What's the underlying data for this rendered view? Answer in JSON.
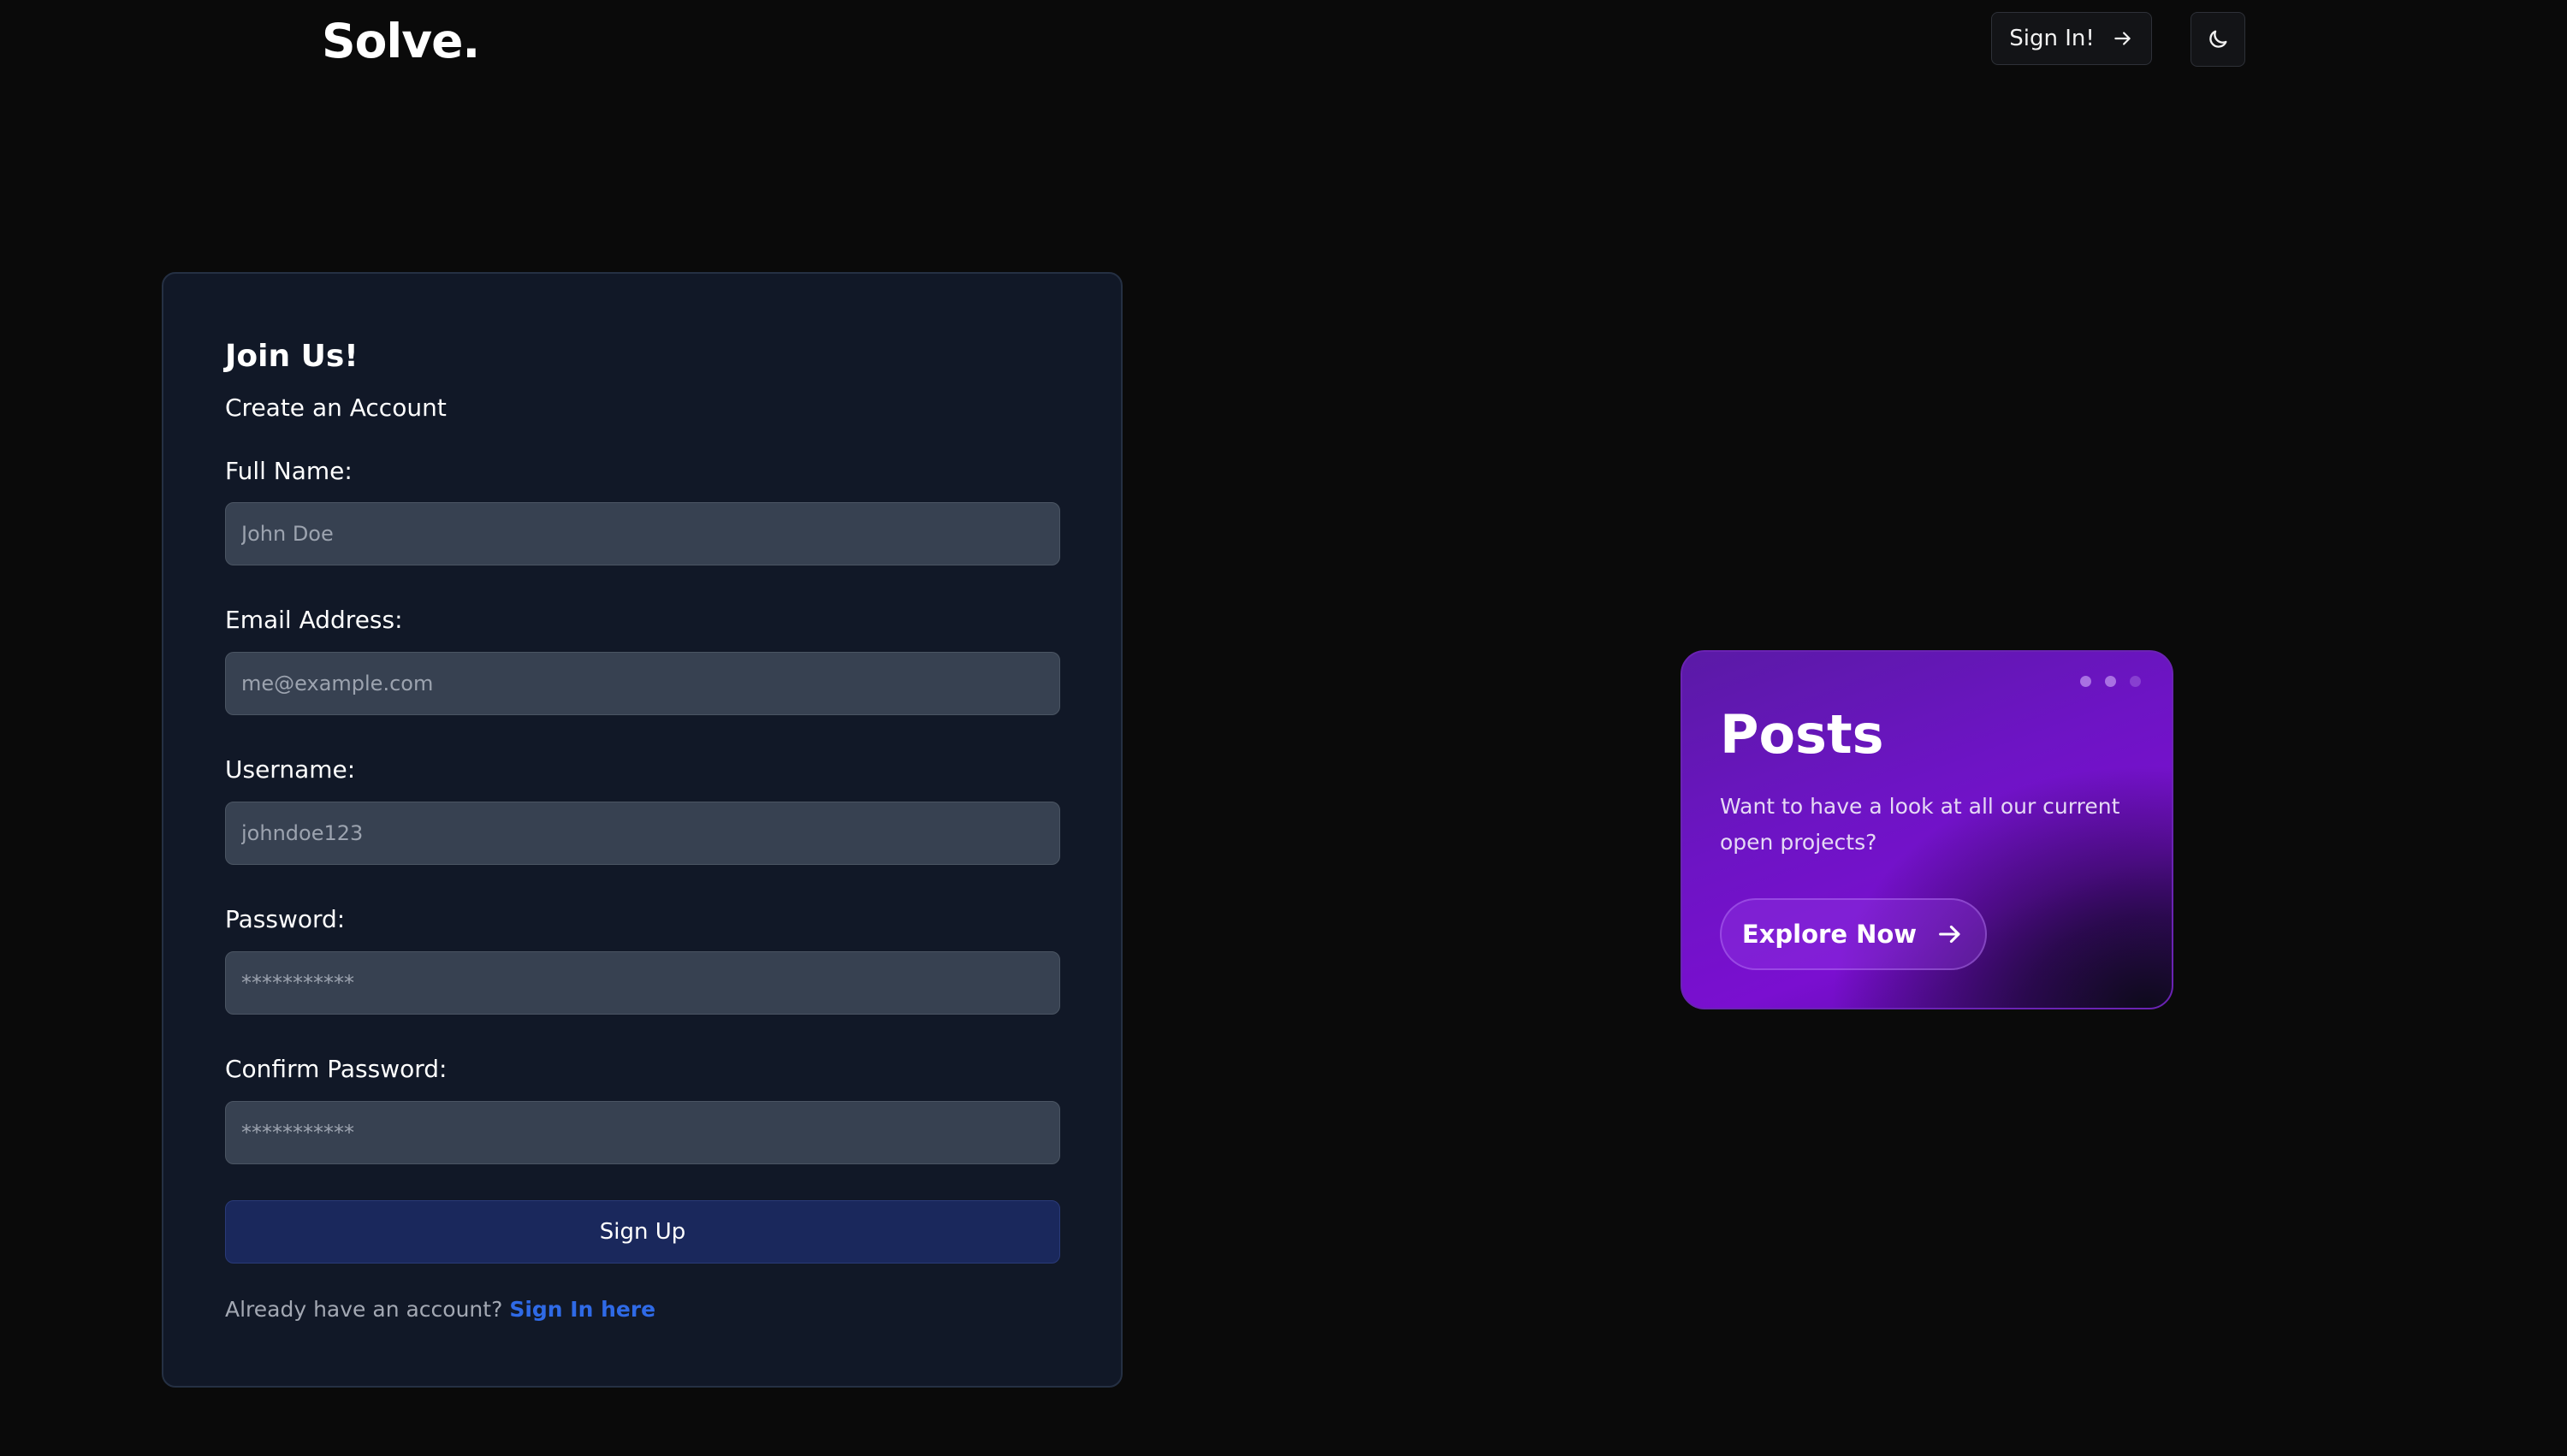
{
  "header": {
    "logo": "Solve.",
    "signin_label": "Sign In!"
  },
  "signup": {
    "title": "Join Us!",
    "subtitle": "Create an Account",
    "fields": [
      {
        "label": "Full Name:",
        "placeholder": "John Doe",
        "value": ""
      },
      {
        "label": "Email Address:",
        "placeholder": "me@example.com",
        "value": ""
      },
      {
        "label": "Username:",
        "placeholder": "johndoe123",
        "value": ""
      },
      {
        "label": "Password:",
        "placeholder": "***********",
        "value": ""
      },
      {
        "label": "Confirm Password:",
        "placeholder": "***********",
        "value": ""
      }
    ],
    "submit_label": "Sign Up",
    "footer_text": "Already have an account?",
    "footer_link": "Sign In here"
  },
  "posts": {
    "title": "Posts",
    "description": "Want to have a look at all our current open projects?",
    "button_label": "Explore Now"
  },
  "icons": {
    "signin": "arrow-right-icon",
    "theme": "moon-icon",
    "explore": "arrow-right-icon"
  },
  "colors": {
    "background": "#0a0a0a",
    "card": "#111827",
    "input": "#374151",
    "submit": "#1a285c",
    "link": "#2f6ae6",
    "posts_accent": "#6d14c4"
  }
}
